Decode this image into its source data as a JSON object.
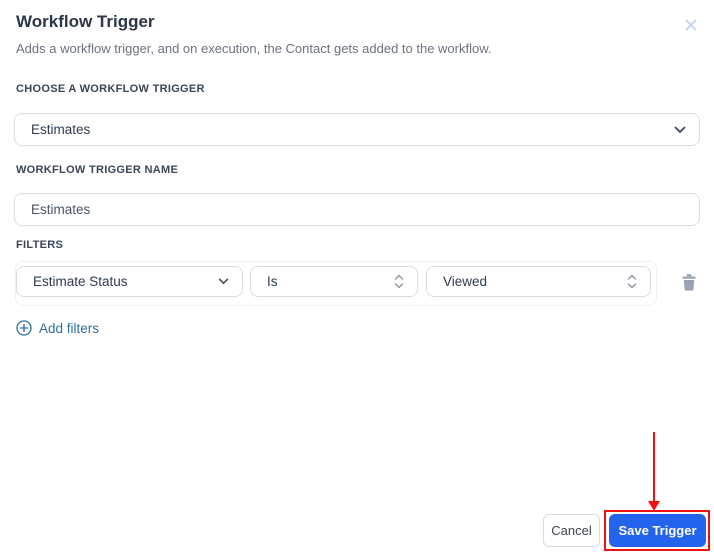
{
  "dialog": {
    "title": "Workflow Trigger",
    "description": "Adds a workflow trigger, and on execution, the Contact gets added to the workflow.",
    "close_icon": "x-close"
  },
  "trigger_select": {
    "label": "CHOOSE A WORKFLOW TRIGGER",
    "value": "Estimates"
  },
  "trigger_name": {
    "label": "WORKFLOW TRIGGER NAME",
    "value": "Estimates"
  },
  "filters": {
    "label": "FILTERS",
    "rows": [
      {
        "field": "Estimate Status",
        "operator": "Is",
        "value": "Viewed"
      }
    ],
    "icons": [
      "chevron-down-icon",
      "unfold-icon",
      "trash-icon",
      "plus-circle-icon"
    ],
    "add_link": "Add filters"
  },
  "footer": {
    "cancel_label": "Cancel",
    "save_label": "Save Trigger"
  },
  "annotation": {
    "type": "red-arrow-and-box",
    "target": "save-trigger-button"
  },
  "colors": {
    "primary": "#2463eb",
    "annotation": "#ee1111",
    "link": "#2e6e9e",
    "title": "#2b3648",
    "label": "#3b4559",
    "description": "#6b7280",
    "border": "#d9dce3"
  }
}
